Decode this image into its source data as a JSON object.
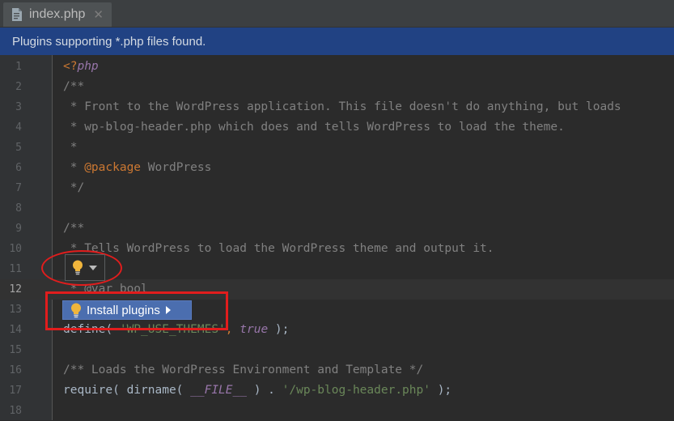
{
  "tab": {
    "label": "index.php",
    "close_glyph": "✕",
    "icon": "php-file-icon"
  },
  "banner": {
    "text": "Plugins supporting *.php files found."
  },
  "editor": {
    "current_line": 12,
    "lines": [
      {
        "n": "1",
        "segments": [
          {
            "t": "<?",
            "c": "c-tag"
          },
          {
            "t": "php",
            "c": "c-php"
          }
        ]
      },
      {
        "n": "2",
        "segments": [
          {
            "t": "/**",
            "c": "c-com"
          }
        ]
      },
      {
        "n": "3",
        "segments": [
          {
            "t": " * Front to the WordPress application. This file doesn't do anything, but loads",
            "c": "c-com"
          }
        ]
      },
      {
        "n": "4",
        "segments": [
          {
            "t": " * wp-blog-header.php which does and tells WordPress to load the theme.",
            "c": "c-com"
          }
        ]
      },
      {
        "n": "5",
        "segments": [
          {
            "t": " *",
            "c": "c-com"
          }
        ]
      },
      {
        "n": "6",
        "segments": [
          {
            "t": " * ",
            "c": "c-com"
          },
          {
            "t": "@package",
            "c": "c-doctag"
          },
          {
            "t": " WordPress",
            "c": "c-com"
          }
        ]
      },
      {
        "n": "7",
        "segments": [
          {
            "t": " */",
            "c": "c-com"
          }
        ]
      },
      {
        "n": "8",
        "segments": []
      },
      {
        "n": "9",
        "segments": [
          {
            "t": "/**",
            "c": "c-com"
          }
        ]
      },
      {
        "n": "10",
        "segments": [
          {
            "t": " * Tells WordPress to load the WordPress theme and output it.",
            "c": "c-com"
          }
        ]
      },
      {
        "n": "11",
        "segments": []
      },
      {
        "n": "12",
        "segments": [
          {
            "t": " * @var bool",
            "c": "c-com"
          }
        ]
      },
      {
        "n": "13",
        "segments": []
      },
      {
        "n": "14",
        "segments": [
          {
            "t": "define( ",
            "c": "c-plain"
          },
          {
            "t": "'WP_USE_THEMES'",
            "c": "c-str"
          },
          {
            "t": ", ",
            "c": "c-kw"
          },
          {
            "t": "true",
            "c": "c-bool"
          },
          {
            "t": " );",
            "c": "c-plain"
          }
        ]
      },
      {
        "n": "15",
        "segments": []
      },
      {
        "n": "16",
        "segments": [
          {
            "t": "/** Loads the WordPress Environment and Template */",
            "c": "c-com"
          }
        ]
      },
      {
        "n": "17",
        "segments": [
          {
            "t": "require( dirname( ",
            "c": "c-plain"
          },
          {
            "t": "__FILE__",
            "c": "c-const"
          },
          {
            "t": " ) . ",
            "c": "c-plain"
          },
          {
            "t": "'/wp-blog-header.php'",
            "c": "c-str"
          },
          {
            "t": " );",
            "c": "c-plain"
          }
        ]
      },
      {
        "n": "18",
        "segments": []
      }
    ]
  },
  "intention": {
    "bulb_icon": "lightbulb-icon",
    "dropdown_icon": "chevron-down-icon",
    "popup_label": "Install plugins",
    "submenu_icon": "chevron-right-icon",
    "bulb_color": "#f0b53c",
    "highlight_color": "#e11d1d"
  }
}
